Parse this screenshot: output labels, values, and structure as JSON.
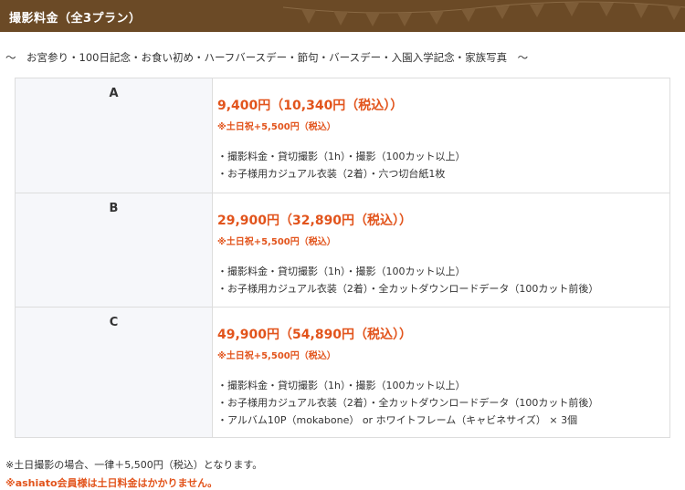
{
  "header": {
    "title": "撮影料金（全3プラン）",
    "bg_color": "#6b4a26",
    "decoration": "bunting-flags"
  },
  "subtitle": "～　お宮参り・100日記念・お食い初め・ハーフバースデー・節句・バースデー・入園入学記念・家族写真　～",
  "plans": [
    {
      "name": "A",
      "price": "9,400円（10,340円（税込））",
      "surcharge": "※土日祝+5,500円（税込）",
      "items": [
        "・撮影料金・貸切撮影（1h）・撮影（100カット以上）",
        "・お子様用カジュアル衣装（2着）・六つ切台紙1枚"
      ]
    },
    {
      "name": "B",
      "price": "29,900円（32,890円（税込））",
      "surcharge": "※土日祝+5,500円（税込）",
      "items": [
        "・撮影料金・貸切撮影（1h）・撮影（100カット以上）",
        "・お子様用カジュアル衣装（2着）・全カットダウンロードデータ（100カット前後）"
      ]
    },
    {
      "name": "C",
      "price": "49,900円（54,890円（税込））",
      "surcharge": "※土日祝+5,500円（税込）",
      "items": [
        "・撮影料金・貸切撮影（1h）・撮影（100カット以上）",
        "・お子様用カジュアル衣装（2着）・全カットダウンロードデータ（100カット前後）",
        "・アルバム10P（mokabone） or ホワイトフレーム（キャビネサイズ） × 3個"
      ]
    }
  ],
  "notes": {
    "weekend": "※土日撮影の場合、一律＋5,500円（税込）となります。",
    "member": "※ashiato会員様は土日料金はかかりません。"
  },
  "colors": {
    "accent": "#e2541c",
    "text": "#333333",
    "label_cell_bg": "#f6f7fa",
    "border": "#dddddd"
  }
}
